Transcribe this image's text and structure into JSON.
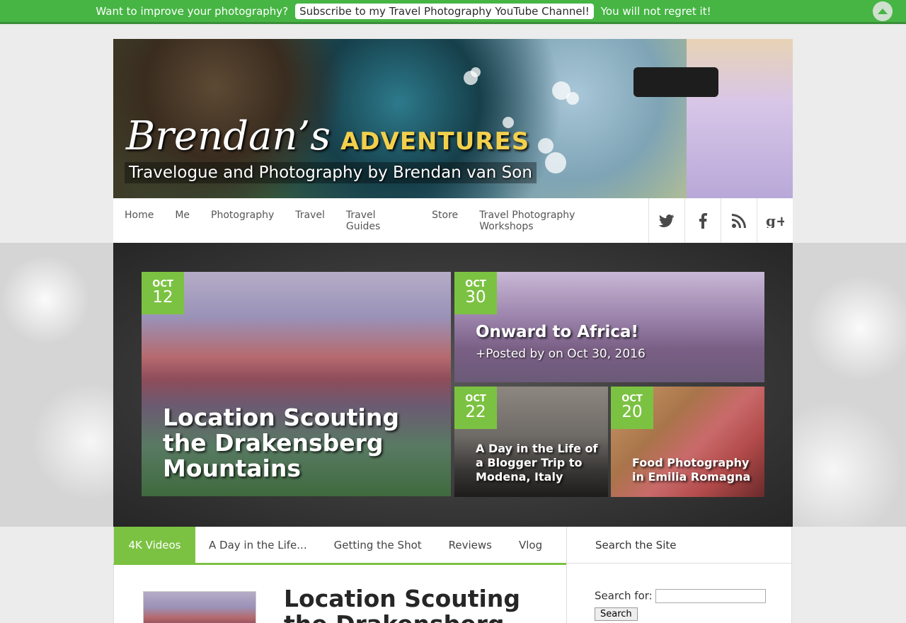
{
  "topbar": {
    "prefix": "Want to improve your photography?",
    "cta": "Subscribe to my Travel Photography YouTube Channel!",
    "suffix": "You will not regret it!",
    "up_icon": "chevron-up-icon"
  },
  "banner": {
    "brand_name": "Brendan’s",
    "brand_suffix": "Adventures",
    "tagline": "Travelogue and Photography by Brendan van Son"
  },
  "nav": {
    "items": [
      "Home",
      "Me",
      "Photography",
      "Travel",
      "Travel Guides",
      "Store",
      "Travel Photography Workshops"
    ],
    "social": [
      {
        "icon": "twitter-icon",
        "glyph": "🐦"
      },
      {
        "icon": "facebook-icon",
        "glyph": "f"
      },
      {
        "icon": "rss-icon",
        "glyph": "◉"
      },
      {
        "icon": "google-plus-icon",
        "glyph": "g+"
      }
    ]
  },
  "featured": [
    {
      "month": "OCT",
      "day": "12",
      "title": "Location Scouting the Drakensberg Mountains"
    },
    {
      "month": "OCT",
      "day": "30",
      "title": "Onward to Africa!",
      "meta": "+Posted by on Oct 30, 2016"
    },
    {
      "month": "OCT",
      "day": "22",
      "title": "A Day in the Life of a Blogger Trip to Modena, Italy"
    },
    {
      "month": "OCT",
      "day": "20",
      "title": "Food Photography in Emilia Romagna"
    }
  ],
  "tabs": [
    "4K Videos",
    "A Day in the Life...",
    "Getting the Shot",
    "Reviews",
    "Vlog"
  ],
  "main": {
    "post_title": "Location Scouting the Drakensberg"
  },
  "sidebar": {
    "heading": "Search the Site",
    "search_label": "Search for:",
    "search_value": "",
    "search_button": "Search"
  },
  "colors": {
    "accent": "#7cc242",
    "topbar": "#46b544"
  }
}
